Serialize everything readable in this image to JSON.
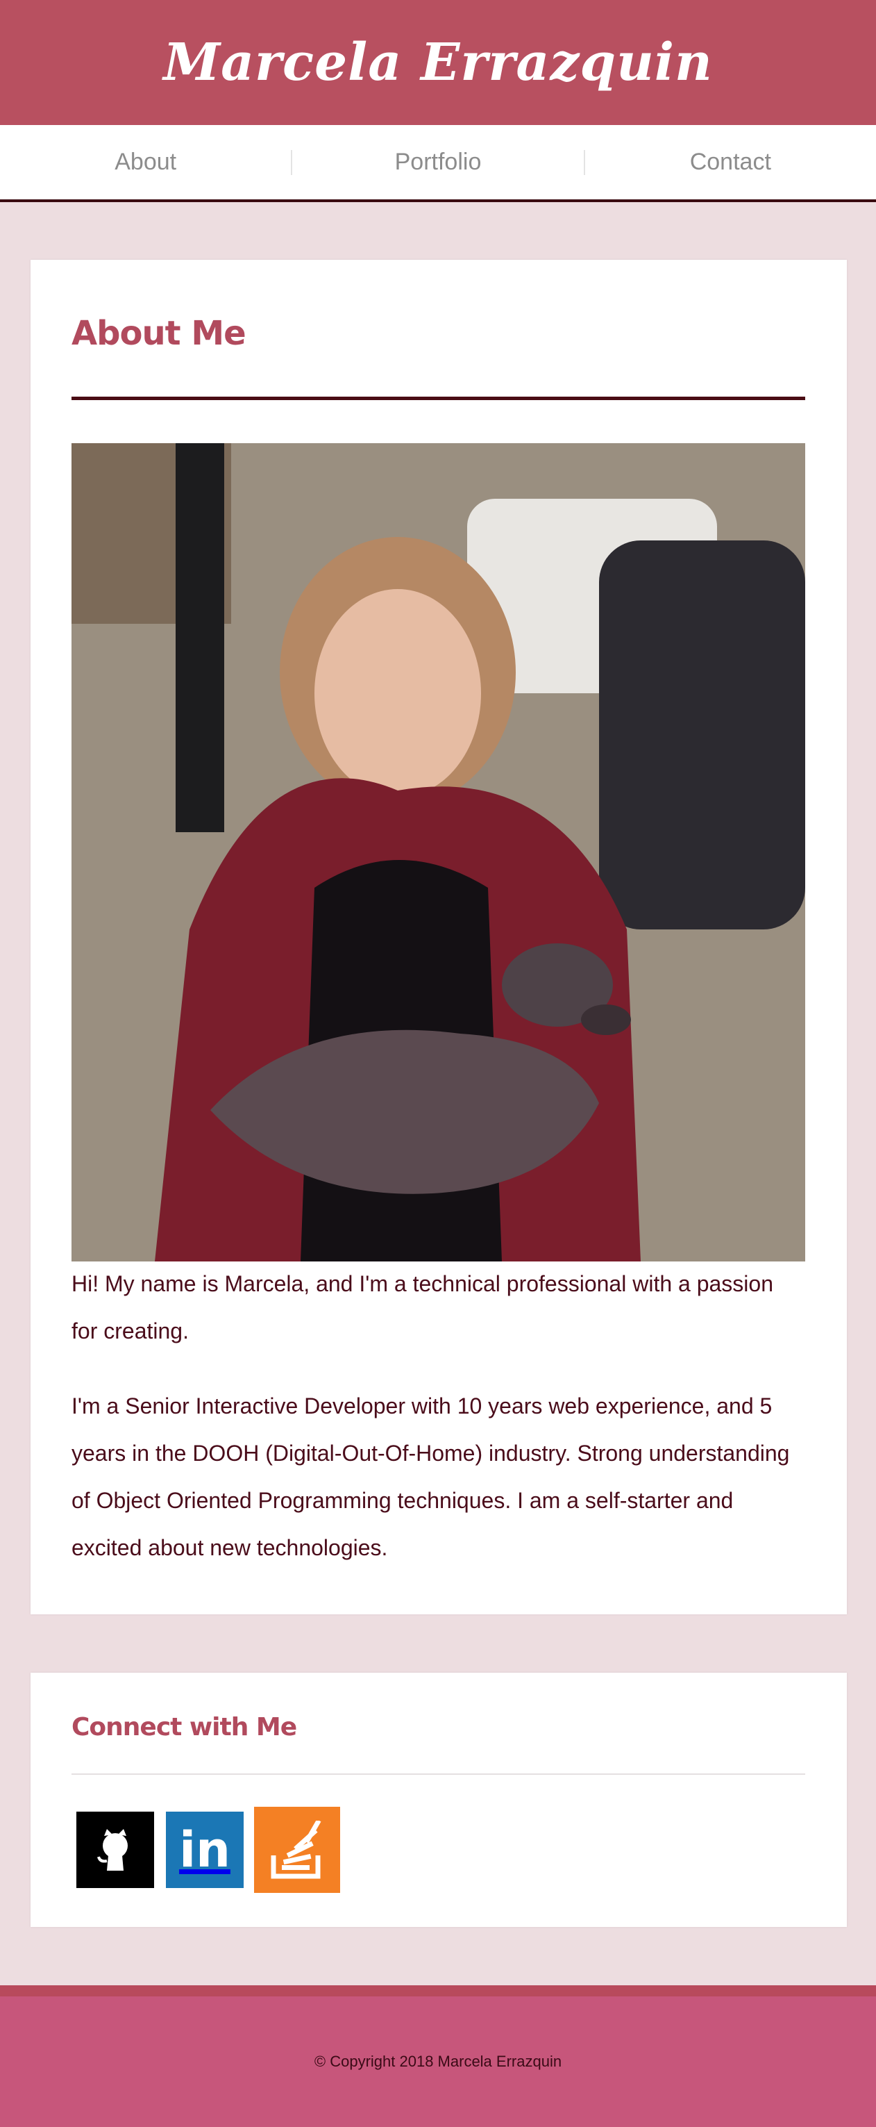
{
  "site": {
    "title": "Marcela Errazquin"
  },
  "nav": {
    "items": [
      {
        "label": "About"
      },
      {
        "label": "Portfolio"
      },
      {
        "label": "Contact"
      }
    ]
  },
  "about": {
    "heading": "About Me",
    "photo_alt": "Portrait of Marcela holding a dog",
    "paragraphs": [
      "Hi! My name is Marcela, and I'm a technical professional with a passion for creating.",
      "I'm a Senior Interactive Developer with 10 years web experience, and 5 years in the DOOH (Digital-Out-Of-Home) industry. Strong understanding of Object Oriented Programming techniques. I am a self-starter and excited about new technologies."
    ]
  },
  "connect": {
    "heading": "Connect with Me",
    "links": [
      {
        "icon": "github-icon",
        "color": "#000000"
      },
      {
        "icon": "linkedin-icon",
        "label": "in",
        "color": "#1b77b5"
      },
      {
        "icon": "stackoverflow-icon",
        "color": "#f48024"
      }
    ]
  },
  "footer": {
    "copyright": "© Copyright 2018 Marcela Errazquin"
  },
  "colors": {
    "header": "#b85060",
    "accent": "#b14a5d",
    "dark": "#4a0c14",
    "footer": "#c7567b",
    "background": "#eddde0"
  }
}
